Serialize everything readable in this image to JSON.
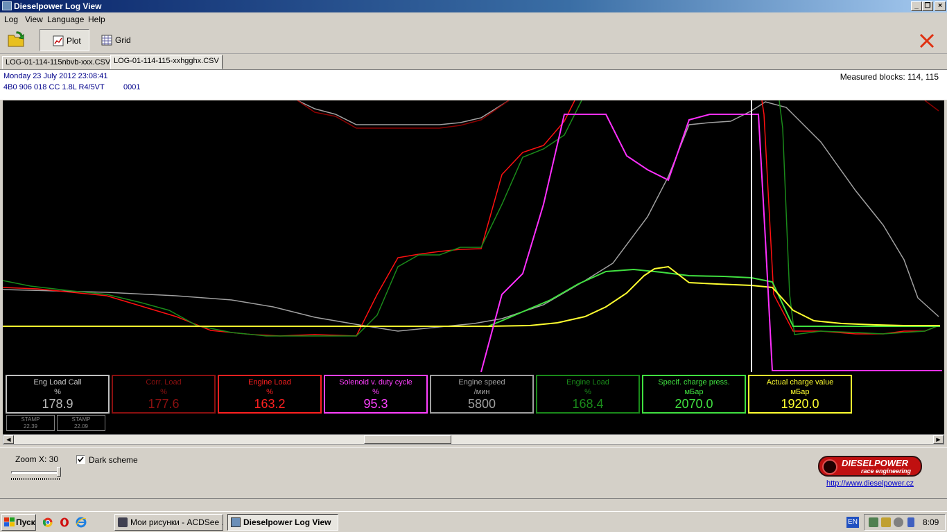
{
  "window": {
    "title": "Dieselpower Log View"
  },
  "menu": [
    "Log",
    "View",
    "Language",
    "Help"
  ],
  "toolbar": {
    "plot_label": "Plot",
    "grid_label": "Grid"
  },
  "tabs": [
    {
      "label": "LOG-01-114-115nbvb-xxx.CSV",
      "active": false
    },
    {
      "label": "LOG-01-114-115-xxhgghx.CSV",
      "active": true
    }
  ],
  "info": {
    "datetime": "Monday 23 July 2012 23:08:41",
    "ecu": "4B0 906 018 CC  1.8L R4/5VT",
    "code": "0001",
    "measured_blocks": "Measured blocks: 114, 115"
  },
  "colors": {
    "eng_load_call": "#c0c0c0",
    "corr_load": "#8b0000",
    "engine_load": "#ff1010",
    "solenoid": "#ff30ff",
    "engine_speed": "#a0a0a0",
    "engine_load_2": "#1a8a1a",
    "specif_charge": "#40e040",
    "actual_charge": "#ffff30"
  },
  "channels": [
    {
      "name": "Eng Load Call",
      "unit": "%",
      "value": "178.9",
      "color": "#c8c8c8",
      "vcolor": "#b8b8b8",
      "border": "#c0c0c0"
    },
    {
      "name": "Corr. Load",
      "unit": "%",
      "value": "177.6",
      "color": "#8b1010",
      "vcolor": "#8b1010",
      "border": "#8b1010"
    },
    {
      "name": "Engine Load",
      "unit": "%",
      "value": "163.2",
      "color": "#ff2020",
      "vcolor": "#ff2020",
      "border": "#ff2020"
    },
    {
      "name": "Solenoid v. duty cycle",
      "unit": "%",
      "value": "95.3",
      "color": "#ff40ff",
      "vcolor": "#ff40ff",
      "border": "#ff40ff"
    },
    {
      "name": "Engine speed",
      "unit": "/мин",
      "value": "5800",
      "color": "#a0a0a0",
      "vcolor": "#a0a0a0",
      "border": "#a0a0a0"
    },
    {
      "name": "Engine Load",
      "unit": "%",
      "value": "168.4",
      "color": "#1a8a1a",
      "vcolor": "#1a8a1a",
      "border": "#1a8a1a"
    },
    {
      "name": "Specif. charge press.",
      "unit": "мБар",
      "value": "2070.0",
      "color": "#40e040",
      "vcolor": "#40e040",
      "border": "#40e040"
    },
    {
      "name": "Actual charge value",
      "unit": "мБар",
      "value": "1920.0",
      "color": "#ffff30",
      "vcolor": "#ffff30",
      "border": "#ffff30"
    }
  ],
  "stamps": [
    {
      "label": "STAMP",
      "value": "22.39"
    },
    {
      "label": "STAMP",
      "value": "22.09"
    }
  ],
  "bottom": {
    "zoom_label": "Zoom X: 30",
    "zoom_value": 30,
    "dark_scheme_label": "Dark scheme",
    "dark_scheme_checked": true,
    "logo_title": "DIESELPOWER",
    "logo_sub": "race engineering",
    "link": "http://www.dieselpower.cz"
  },
  "taskbar": {
    "start_label": "Пуск",
    "tasks": [
      {
        "label": "Мои рисунки - ACDSee ...",
        "active": false
      },
      {
        "label": "Dieselpower Log View",
        "active": true
      }
    ],
    "lang": "EN",
    "clock": "8:09"
  }
}
